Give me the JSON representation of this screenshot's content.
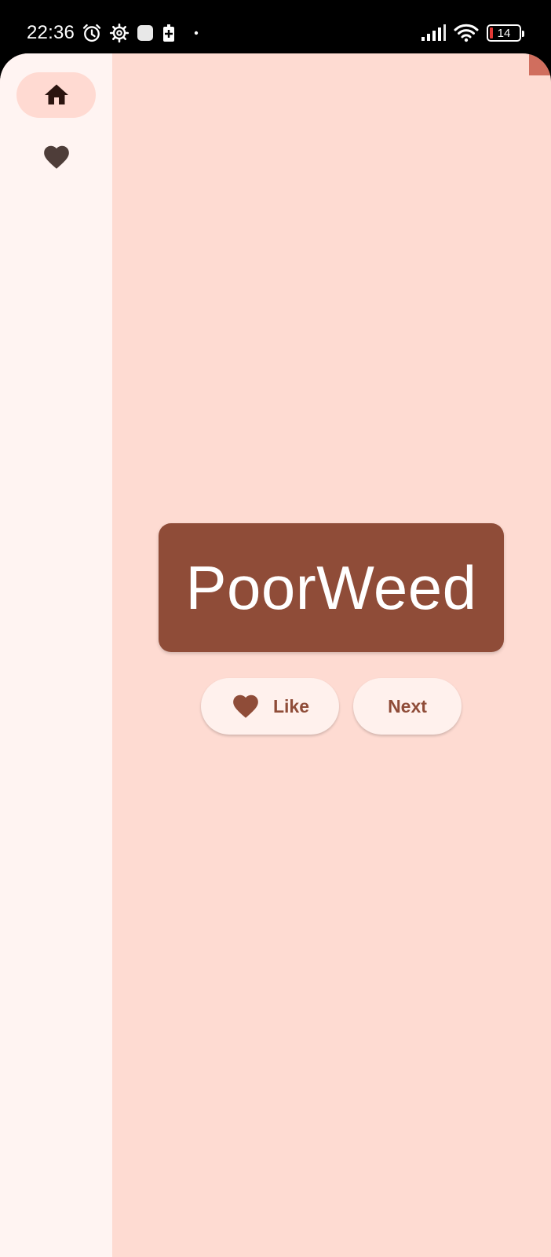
{
  "status_bar": {
    "time": "22:36",
    "icons_left": [
      "alarm-icon",
      "settings-gear-icon",
      "app-notification-icon",
      "battery-saver-icon",
      "dot-icon"
    ],
    "icons_right": [
      "cellular-signal-icon",
      "wifi-icon",
      "battery-icon"
    ],
    "battery_level": "14"
  },
  "navigation_rail": {
    "items": [
      {
        "name": "home",
        "icon": "home-icon",
        "selected": true
      },
      {
        "name": "favorites",
        "icon": "heart-icon",
        "selected": false
      }
    ]
  },
  "main": {
    "word": "PoorWeed",
    "like_label": "Like",
    "next_label": "Next"
  },
  "colors": {
    "background": "#fedbd2",
    "rail": "#fff4f2",
    "rail_selected": "#ffdad2",
    "card": "#8f4c38",
    "button": "#fff1ed",
    "accent_text": "#8f4c38",
    "icon_dark": "#3e2a26"
  }
}
